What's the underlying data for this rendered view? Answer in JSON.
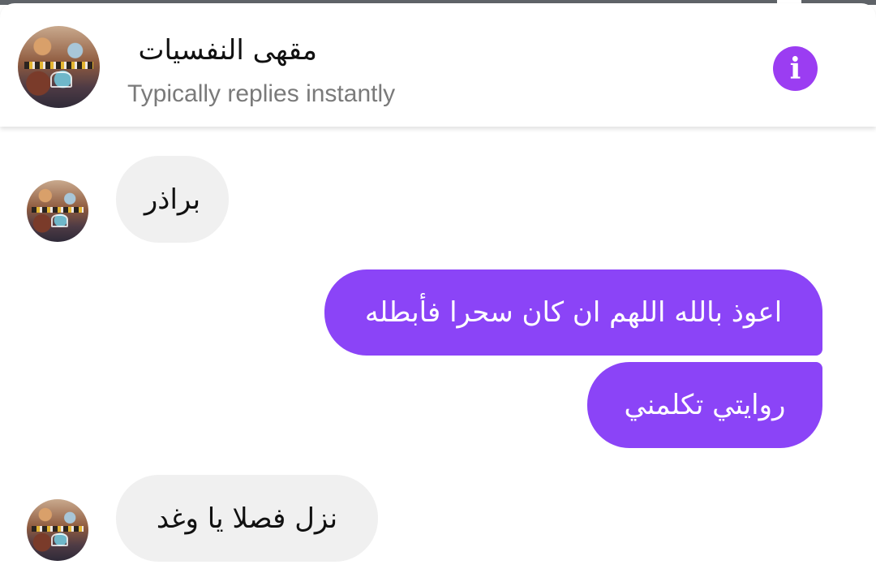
{
  "header": {
    "title": "مقهى النفسيات",
    "subtitle": "Typically replies instantly",
    "info_icon": "i",
    "accent_color": "#9b3df2"
  },
  "messages": [
    {
      "direction": "incoming",
      "text": "براذر"
    },
    {
      "direction": "outgoing",
      "text": "اعوذ بالله اللهم ان كان سحرا فأبطله"
    },
    {
      "direction": "outgoing",
      "text": "روايتي تكلمني"
    },
    {
      "direction": "incoming",
      "text": "نزل فصلا يا وغد"
    }
  ],
  "colors": {
    "incoming_bubble": "#f0f0f0",
    "outgoing_bubble": "#8b44f7",
    "subtitle_text": "#7a7a7a"
  }
}
